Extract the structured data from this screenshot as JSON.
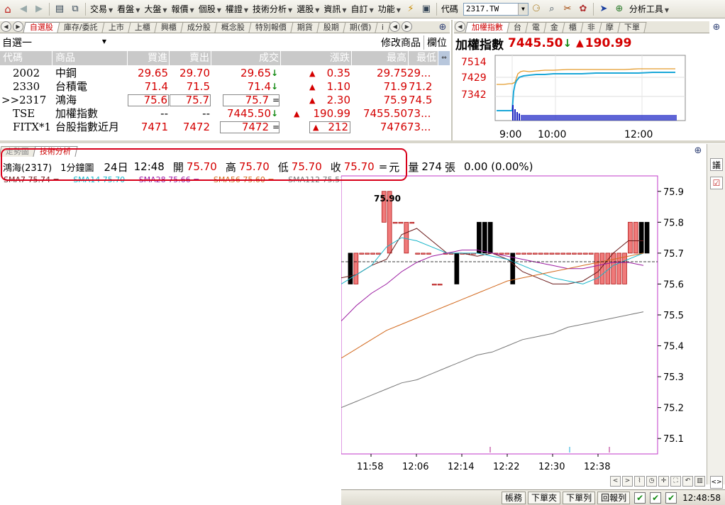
{
  "toolbar": {
    "menus": [
      "交易",
      "看盤",
      "大盤",
      "報價",
      "個股",
      "權證",
      "技術分析",
      "選股",
      "資訊",
      "自訂",
      "功能"
    ],
    "code_label": "代碼",
    "code_value": "2317.TW",
    "analysis_tools": "分析工具"
  },
  "watch_tabs": [
    "自選股",
    "庫存/委託",
    "上市",
    "上櫃",
    "興櫃",
    "成分股",
    "概念股",
    "特別報價",
    "期貨",
    "股期",
    "期(價)",
    "i"
  ],
  "watch": {
    "group": "自選一",
    "modify": "修改商品",
    "columns_btn": "欄位",
    "headers": [
      "代碼",
      "商品",
      "買進",
      "賣出",
      "成交",
      "漲跌",
      "最高",
      "最低"
    ],
    "rows": [
      {
        "code": "2002",
        "name": "中鋼",
        "bid": "29.65",
        "ask": "29.70",
        "last": "29.65",
        "chg": "0.35",
        "high": "29.75",
        "low": "29..."
      },
      {
        "code": "2330",
        "name": "台積電",
        "bid": "71.4",
        "ask": "71.5",
        "last": "71.4",
        "chg": "1.10",
        "high": "71.9",
        "low": "71.2"
      },
      {
        "code": ">>2317",
        "name": "鴻海",
        "bid": "75.6",
        "ask": "75.7",
        "last": "75.7",
        "chg": "2.30",
        "high": "75.9",
        "low": "74.5"
      },
      {
        "code": "TSE",
        "name": "加權指數",
        "bid": "--",
        "ask": "--",
        "last": "7445.50",
        "chg": "190.99",
        "high": "7455.50",
        "low": "73..."
      },
      {
        "code": "FITX*1",
        "name": "台股指數近月",
        "bid": "7471",
        "ask": "7472",
        "last": "7472",
        "chg": "212",
        "high": "7476",
        "low": "73..."
      }
    ]
  },
  "index_tabs": [
    "加權指數",
    "台",
    "電",
    "金",
    "櫃",
    "非",
    "摩",
    "下單"
  ],
  "index": {
    "name": "加權指數",
    "price": "7445.50",
    "change": "190.99",
    "y_ticks": [
      "7514",
      "7429",
      "7342"
    ],
    "x_ticks": [
      "9:00",
      "10:00",
      "12:00"
    ]
  },
  "tech_tabs": [
    "走勢圖",
    "技術分析"
  ],
  "tech": {
    "stock": "鴻海(2317)",
    "period": "1分鐘圖",
    "date": "24日",
    "time": "12:48",
    "open_label": "開",
    "open": "75.70",
    "high_label": "高",
    "high": "75.70",
    "low_label": "低",
    "low": "75.70",
    "close_label": "收",
    "close": "75.70",
    "unit": "元",
    "vol_label": "量",
    "vol": "274",
    "vol_unit": "張",
    "change": "0.00 (0.00%)",
    "sma": [
      "SMA7 75.74 =",
      "SMA14 75.70",
      "SMA28 75.66 =",
      "SMA56 75.60 =",
      "SMA112 75.51 ="
    ],
    "peak_label": "75.90"
  },
  "chart_data": {
    "type": "bar",
    "title": "",
    "y_ticks": [
      "75.9",
      "75.8",
      "75.7",
      "75.6",
      "75.5",
      "75.4",
      "75.3",
      "75.2",
      "75.1"
    ],
    "x_ticks": [
      "11:58",
      "12:06",
      "12:14",
      "12:22",
      "12:30",
      "12:38"
    ],
    "ylim": [
      75.05,
      75.95
    ],
    "candles": [
      {
        "o": 75.7,
        "c": 75.6
      },
      {
        "o": 75.6,
        "c": 75.7
      },
      {
        "o": 75.7,
        "c": 75.7
      },
      {
        "o": 75.7,
        "c": 75.7
      },
      {
        "o": 75.7,
        "c": 75.7
      },
      {
        "o": 75.7,
        "c": 75.7
      },
      {
        "o": 75.8,
        "c": 75.9
      },
      {
        "o": 75.7,
        "c": 75.9
      },
      {
        "o": 75.8,
        "c": 75.8
      },
      {
        "o": 75.8,
        "c": 75.8
      },
      {
        "o": 75.7,
        "c": 75.8
      },
      {
        "o": 75.8,
        "c": 75.8
      },
      {
        "o": 75.7,
        "c": 75.7
      },
      {
        "o": 75.7,
        "c": 75.7
      },
      {
        "o": 75.7,
        "c": 75.7
      },
      {
        "o": 75.6,
        "c": 75.6
      },
      {
        "o": 75.6,
        "c": 75.6
      },
      {
        "o": 75.7,
        "c": 75.7
      },
      {
        "o": 75.7,
        "c": 75.7
      },
      {
        "o": 75.7,
        "c": 75.6
      },
      {
        "o": 75.7,
        "c": 75.7
      },
      {
        "o": 75.7,
        "c": 75.7
      },
      {
        "o": 75.7,
        "c": 75.7
      },
      {
        "o": 75.8,
        "c": 75.7
      },
      {
        "o": 75.8,
        "c": 75.7
      },
      {
        "o": 75.8,
        "c": 75.7
      },
      {
        "o": 75.7,
        "c": 75.7
      },
      {
        "o": 75.7,
        "c": 75.7
      },
      {
        "o": 75.7,
        "c": 75.7
      },
      {
        "o": 75.7,
        "c": 75.6
      },
      {
        "o": 75.7,
        "c": 75.7
      },
      {
        "o": 75.7,
        "c": 75.7
      },
      {
        "o": 75.7,
        "c": 75.7
      },
      {
        "o": 75.7,
        "c": 75.7
      },
      {
        "o": 75.7,
        "c": 75.7
      },
      {
        "o": 75.7,
        "c": 75.7
      },
      {
        "o": 75.7,
        "c": 75.7
      },
      {
        "o": 75.7,
        "c": 75.7
      },
      {
        "o": 75.7,
        "c": 75.7
      },
      {
        "o": 75.7,
        "c": 75.7
      },
      {
        "o": 75.7,
        "c": 75.7
      },
      {
        "o": 75.7,
        "c": 75.7
      },
      {
        "o": 75.7,
        "c": 75.7
      },
      {
        "o": 75.7,
        "c": 75.7
      },
      {
        "o": 75.6,
        "c": 75.7
      },
      {
        "o": 75.6,
        "c": 75.7
      },
      {
        "o": 75.6,
        "c": 75.7
      },
      {
        "o": 75.6,
        "c": 75.7
      },
      {
        "o": 75.6,
        "c": 75.7
      },
      {
        "o": 75.6,
        "c": 75.7
      },
      {
        "o": 75.7,
        "c": 75.8
      },
      {
        "o": 75.7,
        "c": 75.8
      },
      {
        "o": 75.8,
        "c": 75.7
      },
      {
        "o": 75.8,
        "c": 75.7
      }
    ],
    "series": [
      {
        "name": "SMA7",
        "color": "#6b1a1a",
        "values": [
          75.62,
          75.63,
          75.66,
          75.68,
          75.76,
          75.78,
          75.74,
          75.7,
          75.7,
          75.69,
          75.7,
          75.68,
          75.64,
          75.62,
          75.6,
          75.6,
          75.61,
          75.64,
          75.7,
          75.74,
          75.74
        ]
      },
      {
        "name": "SMA14",
        "color": "#17b5c9",
        "values": [
          75.6,
          75.63,
          75.66,
          75.72,
          75.75,
          75.74,
          75.72,
          75.7,
          75.7,
          75.7,
          75.69,
          75.68,
          75.66,
          75.64,
          75.62,
          75.61,
          75.6,
          75.62,
          75.66,
          75.68,
          75.7
        ]
      },
      {
        "name": "SMA28",
        "color": "#9a1aa0",
        "values": [
          75.48,
          75.53,
          75.57,
          75.6,
          75.64,
          75.67,
          75.69,
          75.7,
          75.71,
          75.71,
          75.7,
          75.69,
          75.68,
          75.67,
          75.66,
          75.65,
          75.65,
          75.66,
          75.67,
          75.67,
          75.66
        ]
      },
      {
        "name": "SMA56",
        "color": "#d2691e",
        "values": [
          75.36,
          75.39,
          75.42,
          75.45,
          75.47,
          75.49,
          75.51,
          75.53,
          75.55,
          75.57,
          75.59,
          75.61,
          75.62,
          75.63,
          75.64,
          75.65,
          75.66,
          75.67,
          75.68,
          75.69,
          75.7
        ]
      },
      {
        "name": "SMA112",
        "color": "#777777",
        "values": [
          75.2,
          75.22,
          75.24,
          75.26,
          75.28,
          75.29,
          75.31,
          75.33,
          75.35,
          75.37,
          75.38,
          75.4,
          75.42,
          75.43,
          75.44,
          75.46,
          75.47,
          75.48,
          75.49,
          75.5,
          75.51
        ]
      }
    ]
  },
  "statusbar": {
    "buttons": [
      "帳務",
      "下單夾",
      "下單列",
      "回報列"
    ],
    "time": "12:48:58"
  },
  "right_tools": {
    "label": "議"
  }
}
